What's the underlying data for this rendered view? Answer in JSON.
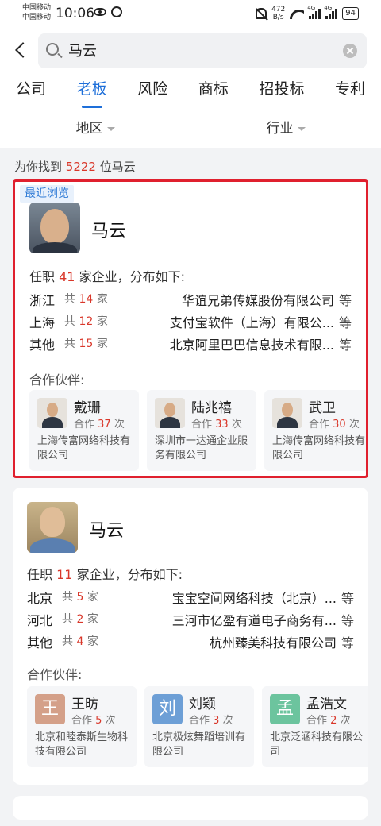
{
  "status_bar": {
    "carrier_1": "中国移动",
    "carrier_2": "中国移动",
    "time": "10:06",
    "speed_value": "472",
    "speed_unit": "B/s",
    "signal_1": "4G",
    "signal_2": "4G",
    "battery": "94"
  },
  "search": {
    "query": "马云"
  },
  "tabs": [
    {
      "label": "公司"
    },
    {
      "label": "老板",
      "active": true
    },
    {
      "label": "风险"
    },
    {
      "label": "商标"
    },
    {
      "label": "招投标"
    },
    {
      "label": "专利"
    }
  ],
  "filters": {
    "region": "地区",
    "industry": "行业"
  },
  "result": {
    "prefix": "为你找到",
    "count": "5222",
    "suffix": "位马云"
  },
  "colors": {
    "accent": "#1e6fd9",
    "highlight_number": "#d9372a",
    "recent_border": "#e0202e"
  },
  "cards": [
    {
      "badge": "最近浏览",
      "name": "马云",
      "tenure_prefix": "任职",
      "tenure_count": "41",
      "tenure_suffix": "家企业，分布如下:",
      "regions": [
        {
          "name": "浙江",
          "count_prefix": "共",
          "count": "14",
          "count_suffix": "家",
          "company": "华谊兄弟传媒股份有限公司",
          "more": "等"
        },
        {
          "name": "上海",
          "count_prefix": "共",
          "count": "12",
          "count_suffix": "家",
          "company": "支付宝软件（上海）有限公...",
          "more": "等"
        },
        {
          "name": "其他",
          "count_prefix": "共",
          "count": "15",
          "count_suffix": "家",
          "company": "北京阿里巴巴信息技术有限...",
          "more": "等"
        }
      ],
      "partners_label": "合作伙伴:",
      "partners": [
        {
          "name": "戴珊",
          "count_prefix": "合作",
          "count": "37",
          "count_suffix": "次",
          "company": "上海传富网络科技有限公司"
        },
        {
          "name": "陆兆禧",
          "count_prefix": "合作",
          "count": "33",
          "count_suffix": "次",
          "company": "深圳市一达通企业服务有限公司"
        },
        {
          "name": "武卫",
          "count_prefix": "合作",
          "count": "30",
          "count_suffix": "次",
          "company": "上海传富网络科技有限公司"
        }
      ]
    },
    {
      "name": "马云",
      "tenure_prefix": "任职",
      "tenure_count": "11",
      "tenure_suffix": "家企业，分布如下:",
      "regions": [
        {
          "name": "北京",
          "count_prefix": "共",
          "count": "5",
          "count_suffix": "家",
          "company": "宝宝空间网络科技（北京）...",
          "more": "等"
        },
        {
          "name": "河北",
          "count_prefix": "共",
          "count": "2",
          "count_suffix": "家",
          "company": "三河市亿盈有道电子商务有...",
          "more": "等"
        },
        {
          "name": "其他",
          "count_prefix": "共",
          "count": "4",
          "count_suffix": "家",
          "company": "杭州臻美科技有限公司",
          "more": "等"
        }
      ],
      "partners_label": "合作伙伴:",
      "partners": [
        {
          "name": "王昉",
          "avatar_letter": "王",
          "avatar_color": "#d4a089",
          "count_prefix": "合作",
          "count": "5",
          "count_suffix": "次",
          "company": "北京和睦泰斯生物科技有限公司"
        },
        {
          "name": "刘颖",
          "avatar_letter": "刘",
          "avatar_color": "#6d9fd6",
          "count_prefix": "合作",
          "count": "3",
          "count_suffix": "次",
          "company": "北京极炫舞蹈培训有限公司"
        },
        {
          "name": "孟浩文",
          "avatar_letter": "孟",
          "avatar_color": "#6cc49e",
          "count_prefix": "合作",
          "count": "2",
          "count_suffix": "次",
          "company": "北京泛涵科技有限公司"
        }
      ]
    }
  ]
}
